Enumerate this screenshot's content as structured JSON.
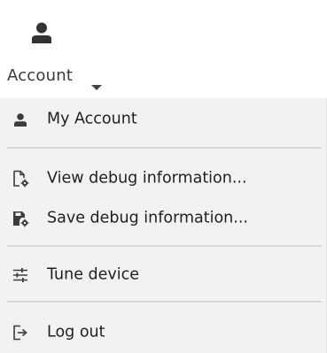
{
  "header": {
    "user_icon": "user-icon",
    "label": "Account",
    "caret_icon": "caret-down-icon"
  },
  "menu": {
    "items": [
      {
        "label": "My Account",
        "icon": "user-icon"
      },
      {
        "label": "View debug information...",
        "icon": "view-debug-icon"
      },
      {
        "label": "Save debug information...",
        "icon": "save-debug-icon"
      },
      {
        "label": "Tune device",
        "icon": "tune-sliders-icon"
      },
      {
        "label": "Log out",
        "icon": "logout-icon"
      }
    ]
  },
  "colors": {
    "menu_background": "#f2f2f2",
    "separator": "#d7d7d7",
    "text": "#1f1f1f",
    "icon": "#3c3c3c"
  }
}
